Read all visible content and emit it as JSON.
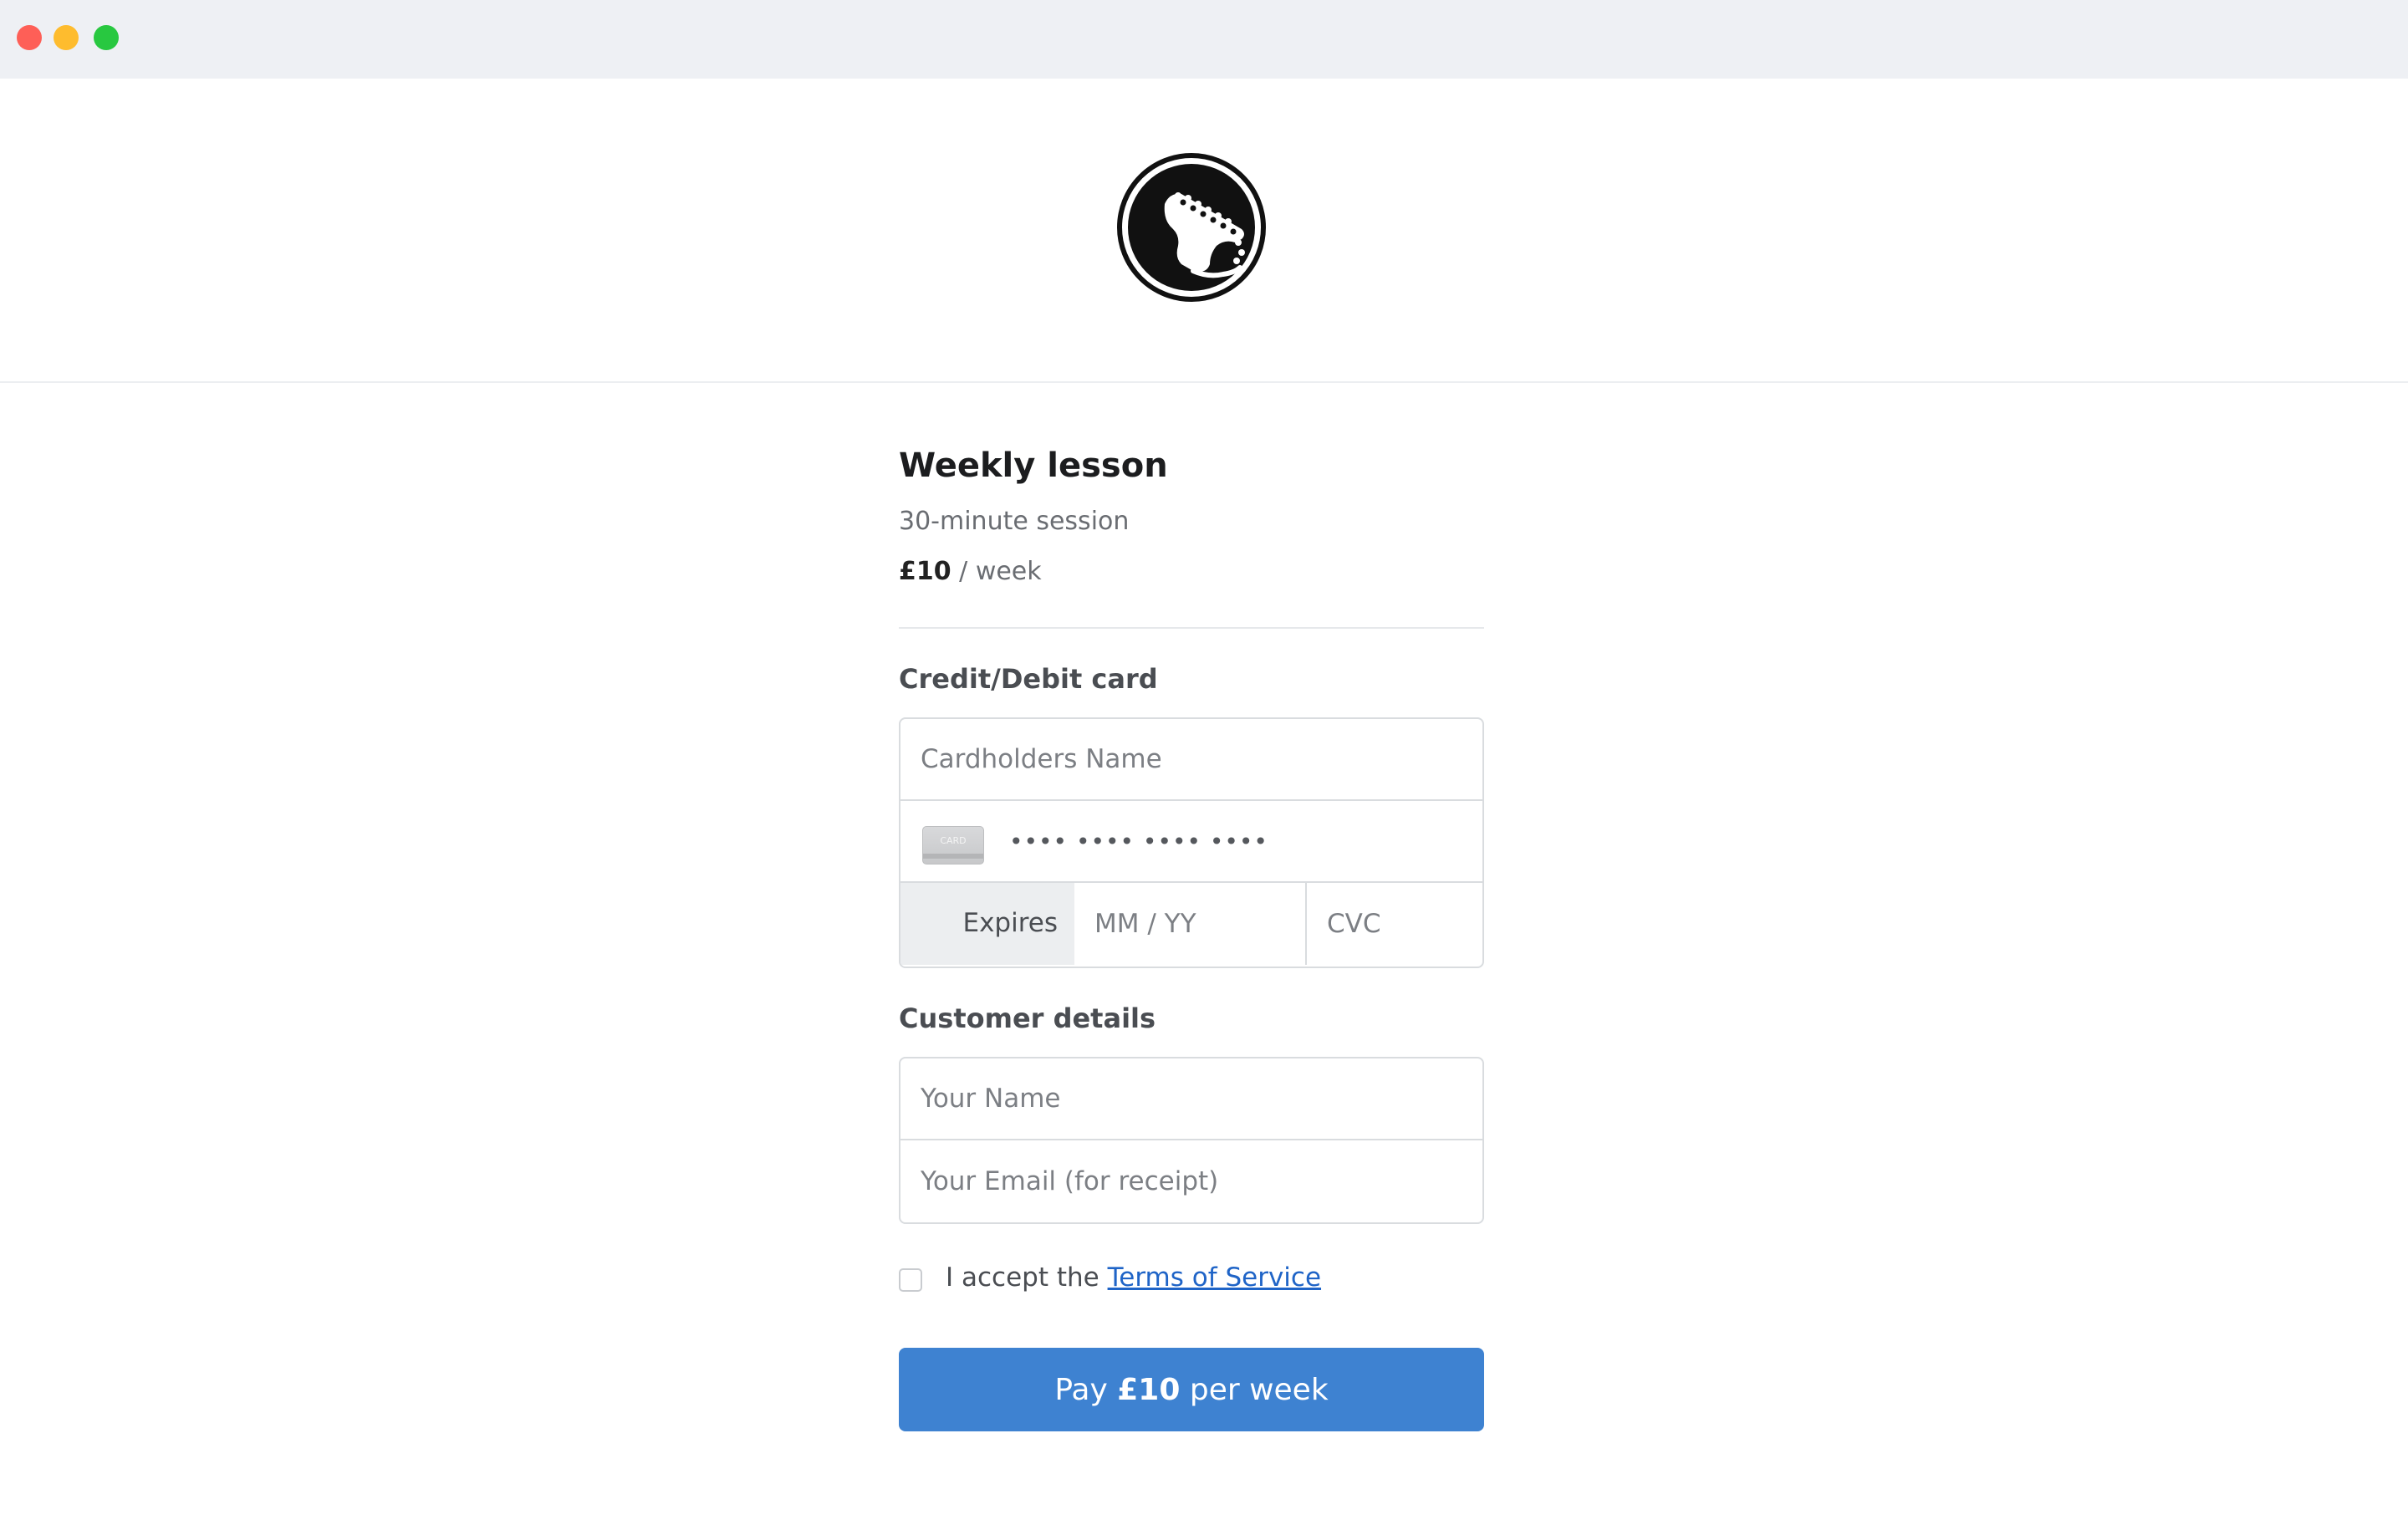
{
  "window": {
    "controls": [
      "close",
      "minimize",
      "maximize"
    ]
  },
  "header": {
    "logo_icon": "guitar-headstock-icon"
  },
  "product": {
    "title": "Weekly lesson",
    "subtitle": "30-minute session",
    "price_amount": "£10",
    "price_period": "/ week"
  },
  "card_section": {
    "label": "Credit/Debit card",
    "cardholder_placeholder": "Cardholders Name",
    "card_icon_text": "CARD",
    "card_number_placeholder": "•••• •••• •••• ••••",
    "expires_label": "Expires",
    "expiry_placeholder": "MM / YY",
    "cvc_placeholder": "CVC"
  },
  "customer_section": {
    "label": "Customer details",
    "name_placeholder": "Your Name",
    "email_placeholder": "Your Email (for receipt)"
  },
  "terms": {
    "prefix": "I accept the",
    "link_text": "Terms of Service",
    "checked": false
  },
  "pay_button": {
    "prefix": "Pay",
    "amount": "£10",
    "suffix": "per week"
  },
  "colors": {
    "accent": "#3e82d1",
    "link": "#1f64c7",
    "titlebar": "#eef0f4"
  }
}
